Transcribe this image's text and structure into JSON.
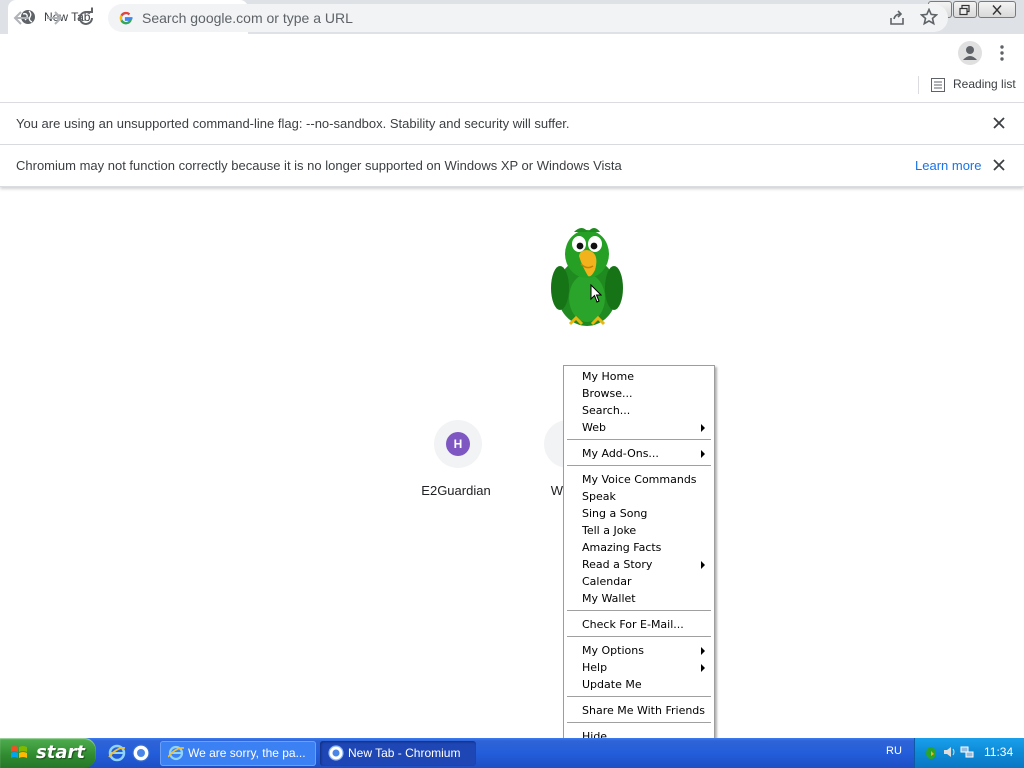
{
  "browser": {
    "tab": {
      "title": "New Tab"
    },
    "omnibox": {
      "placeholder": "Search google.com or type a URL"
    },
    "bookmarks_bar": {
      "reading_list": "Reading list"
    },
    "infobars": [
      {
        "message": "You are using an unsupported command-line flag: --no-sandbox. Stability and security will suffer."
      },
      {
        "message": "Chromium may not function correctly because it is no longer supported on Windows XP or Windows Vista",
        "link": "Learn more"
      }
    ]
  },
  "ntp": {
    "shortcuts": [
      {
        "label": "E2Guardian",
        "initial": "H"
      },
      {
        "label": "Web"
      }
    ]
  },
  "context_menu": {
    "items": [
      {
        "label": "My Home"
      },
      {
        "label": "Browse..."
      },
      {
        "label": "Search..."
      },
      {
        "label": "Web",
        "submenu": true
      },
      {
        "separator": true
      },
      {
        "label": "My Add-Ons...",
        "submenu": true
      },
      {
        "separator": true
      },
      {
        "label": "My Voice Commands"
      },
      {
        "label": "Speak"
      },
      {
        "label": "Sing a Song"
      },
      {
        "label": "Tell a Joke"
      },
      {
        "label": "Amazing Facts"
      },
      {
        "label": "Read a Story",
        "submenu": true
      },
      {
        "label": "Calendar"
      },
      {
        "label": "My Wallet"
      },
      {
        "separator": true
      },
      {
        "label": "Check For E-Mail..."
      },
      {
        "separator": true
      },
      {
        "label": "My Options",
        "submenu": true
      },
      {
        "label": "Help",
        "submenu": true
      },
      {
        "label": "Update Me"
      },
      {
        "separator": true
      },
      {
        "label": "Share Me With Friends"
      },
      {
        "separator": true
      },
      {
        "label": "Hide"
      }
    ]
  },
  "taskbar": {
    "start_label": "start",
    "buttons": [
      {
        "label": "We are sorry, the pa...",
        "icon": "ie-icon"
      },
      {
        "label": "New Tab - Chromium",
        "icon": "chromium-icon",
        "active": true
      }
    ],
    "language": "RU",
    "clock": "11:34"
  },
  "colors": {
    "accent_link": "#1a73e8",
    "taskbar_blue": "#245edb",
    "start_green": "#2f8a2f",
    "tray_blue": "#0c8ad6"
  }
}
